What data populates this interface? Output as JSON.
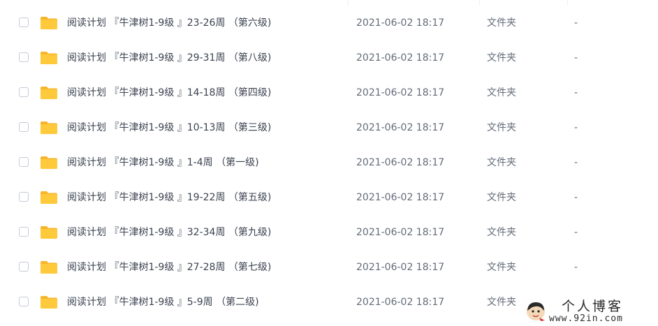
{
  "colors": {
    "folder": "#ffc93c",
    "folder_dark": "#f7b52b",
    "checkbox_border": "#c5cbd5",
    "text_primary": "#3b4250",
    "text_secondary": "#636b78"
  },
  "rows": [
    {
      "name": "阅读计划 『牛津树1-9级 』23-26周 （第六级)",
      "date": "2021-06-02 18:17",
      "type": "文件夹",
      "size": "-",
      "icon": "folder-icon"
    },
    {
      "name": "阅读计划 『牛津树1-9级 』29-31周 （第八级)",
      "date": "2021-06-02 18:17",
      "type": "文件夹",
      "size": "-",
      "icon": "folder-icon"
    },
    {
      "name": "阅读计划 『牛津树1-9级 』14-18周 （第四级)",
      "date": "2021-06-02 18:17",
      "type": "文件夹",
      "size": "-",
      "icon": "folder-icon"
    },
    {
      "name": "阅读计划 『牛津树1-9级 』10-13周 （第三级)",
      "date": "2021-06-02 18:17",
      "type": "文件夹",
      "size": "-",
      "icon": "folder-icon"
    },
    {
      "name": "阅读计划 『牛津树1-9级 』1-4周 （第一级)",
      "date": "2021-06-02 18:17",
      "type": "文件夹",
      "size": "-",
      "icon": "folder-icon"
    },
    {
      "name": "阅读计划 『牛津树1-9级 』19-22周 （第五级)",
      "date": "2021-06-02 18:17",
      "type": "文件夹",
      "size": "-",
      "icon": "folder-icon"
    },
    {
      "name": "阅读计划 『牛津树1-9级 』32-34周 （第九级)",
      "date": "2021-06-02 18:17",
      "type": "文件夹",
      "size": "-",
      "icon": "folder-icon"
    },
    {
      "name": "阅读计划 『牛津树1-9级 』27-28周 （第七级)",
      "date": "2021-06-02 18:17",
      "type": "文件夹",
      "size": "-",
      "icon": "folder-icon"
    },
    {
      "name": "阅读计划 『牛津树1-9级 』5-9周 （第二级)",
      "date": "2021-06-02 18:17",
      "type": "文件夹",
      "size": "",
      "icon": "folder-icon"
    }
  ],
  "watermark": {
    "title": "个人博客",
    "url": "www.92in.com",
    "icon": "avatar-icon"
  }
}
